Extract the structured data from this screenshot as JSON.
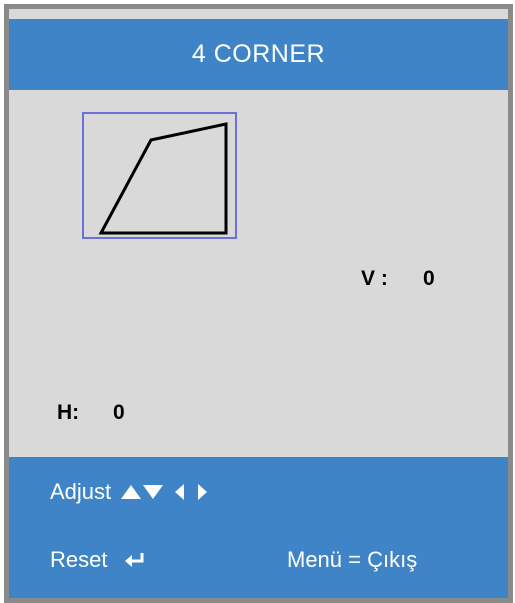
{
  "header": {
    "title": "4 CORNER"
  },
  "preview": {
    "shape": "keystone-quadrilateral-icon"
  },
  "vertical": {
    "label": "V :",
    "value": "0"
  },
  "horizontal": {
    "label": "H:",
    "value": "0"
  },
  "footer": {
    "adjust_label": "Adjust",
    "adjust_icons": [
      "arrow-up-icon",
      "arrow-down-icon",
      "arrow-left-icon",
      "arrow-right-icon"
    ],
    "reset_label": "Reset",
    "reset_icon": "enter-icon",
    "exit_label": "Menü = Çıkış"
  },
  "colors": {
    "panel_background": "#d9d9d9",
    "bar_blue": "#3f84c6",
    "frame_gray": "#8a8a8a",
    "preview_border": "#6f6fd8"
  }
}
